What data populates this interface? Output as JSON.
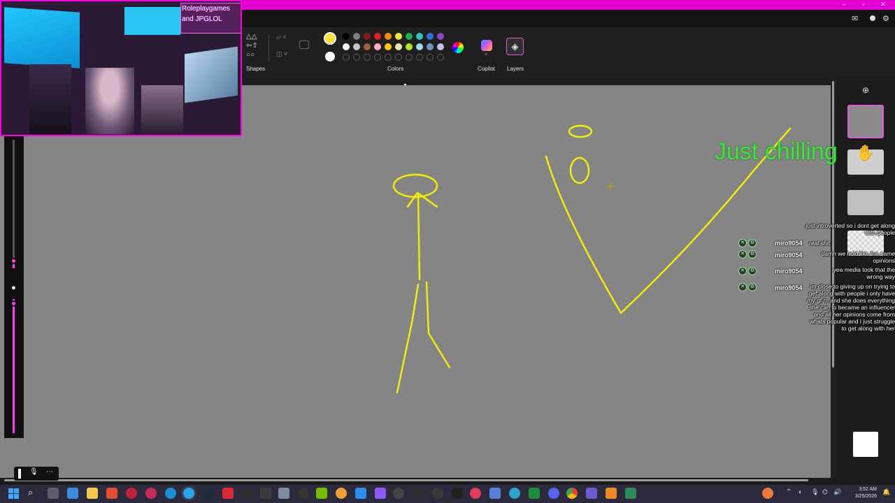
{
  "ribbon": {
    "shapes_label": "Shapes",
    "colors_label": "Colors",
    "copilot_label": "Copilot",
    "layers_label": "Layers",
    "selected_color": "#ffe135",
    "palette_row1": [
      "#000000",
      "#7f7f7f",
      "#8b1a1a",
      "#e02020",
      "#ff8a00",
      "#ffe135",
      "#1bb24a",
      "#2ec4c4",
      "#2f6fe0",
      "#8e44c7"
    ],
    "palette_row2": [
      "#ffffff",
      "#c3c3c3",
      "#a0643a",
      "#ffaec9",
      "#ffc90e",
      "#efe4b0",
      "#b5e61d",
      "#99d9ea",
      "#7092be",
      "#c8bfe7"
    ]
  },
  "webcam": {
    "overlay_line1": "Roleplaygames",
    "overlay_line2": "and JPGLOL"
  },
  "stream_overlay": {
    "status_text": "Just chilling"
  },
  "chat": {
    "messages": [
      {
        "user": "",
        "text": "just introverted so i dont get along with people"
      },
      {
        "user": "miro9054",
        "text": "real shit"
      },
      {
        "user": "miro9054",
        "text": "damn we hold like the same opinions"
      },
      {
        "user": "miro9054",
        "text": "yea media took that the wrong way"
      },
      {
        "user": "miro9054",
        "text": "im close to giving up on trying to get along with people i only have my gf rn and she does everything she can to became an influencer and all her opinions come from whats popular and i just struggle to get along with her"
      }
    ]
  },
  "tray": {
    "time": "3:52 AM",
    "date": "3/25/2026"
  }
}
